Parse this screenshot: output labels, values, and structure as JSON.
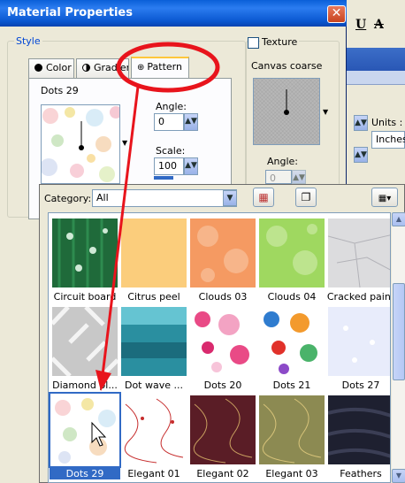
{
  "dialog": {
    "title": "Material Properties",
    "close_glyph": "✕"
  },
  "style_group": {
    "label": "Style",
    "tabs": [
      "Color",
      "Gradient",
      "Pattern"
    ],
    "active_tab": "Pattern"
  },
  "pattern": {
    "name": "Dots 29",
    "angle_label": "Angle:",
    "angle_value": "0",
    "scale_label": "Scale:",
    "scale_value": "100"
  },
  "texture": {
    "checkbox_label": "Texture",
    "name": "Canvas coarse",
    "angle_label": "Angle:",
    "angle_value": "0"
  },
  "background_app": {
    "underline_glyph": "U",
    "strike_glyph": "A",
    "units_label": "Units :",
    "units_value": "Inches"
  },
  "picker": {
    "category_label": "Category:",
    "category_value": "All",
    "items": [
      {
        "label": "Circuit board",
        "style": "circuit"
      },
      {
        "label": "Citrus peel",
        "style": "citrus"
      },
      {
        "label": "Clouds 03",
        "style": "clouds03"
      },
      {
        "label": "Clouds 04",
        "style": "clouds04"
      },
      {
        "label": "Cracked paint",
        "style": "cracked"
      },
      {
        "label": "Diamond pl...",
        "style": "diamond"
      },
      {
        "label": "Dot wave ...",
        "style": "dotwave"
      },
      {
        "label": "Dots 20",
        "style": "dots20"
      },
      {
        "label": "Dots 21",
        "style": "dots21"
      },
      {
        "label": "Dots 27",
        "style": "dots27"
      },
      {
        "label": "Dots 29",
        "style": "dots29",
        "selected": true
      },
      {
        "label": "Elegant 01",
        "style": "elegant01"
      },
      {
        "label": "Elegant 02",
        "style": "elegant02"
      },
      {
        "label": "Elegant 03",
        "style": "elegant03"
      },
      {
        "label": "Feathers",
        "style": "feathers"
      }
    ]
  },
  "colors": {
    "annotation_red": "#e8141c",
    "selection_blue": "#316ac5",
    "titlebar_blue": "#0a5fd8"
  }
}
